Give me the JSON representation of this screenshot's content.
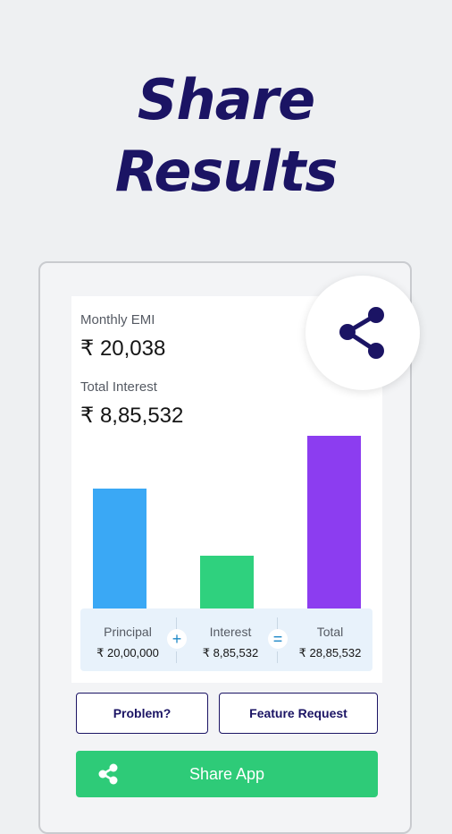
{
  "headline": {
    "line1": "Share",
    "line2": "Results"
  },
  "emi": {
    "label": "Monthly EMI",
    "value": "₹ 20,038"
  },
  "interest": {
    "label": "Total Interest",
    "value": "₹ 8,85,532"
  },
  "chart_data": {
    "type": "bar",
    "categories": [
      "Principal",
      "Interest",
      "Total"
    ],
    "values": [
      2000000,
      885532,
      2885532
    ],
    "colors": [
      "#3aa8f5",
      "#2fd17e",
      "#8c3df0"
    ]
  },
  "summary": {
    "principal": {
      "label": "Principal",
      "value": "₹ 20,00,000"
    },
    "plus": "+",
    "interest": {
      "label": "Interest",
      "value": "₹ 8,85,532"
    },
    "equals": "=",
    "total": {
      "label": "Total",
      "value": "₹ 28,85,532"
    }
  },
  "buttons": {
    "problem": "Problem?",
    "feature": "Feature Request",
    "share_app": "Share App"
  },
  "icons": {
    "share_fab": "share-icon",
    "share_app": "share-icon"
  },
  "colors": {
    "brand": "#1b1464",
    "share_button": "#2ecb78"
  }
}
